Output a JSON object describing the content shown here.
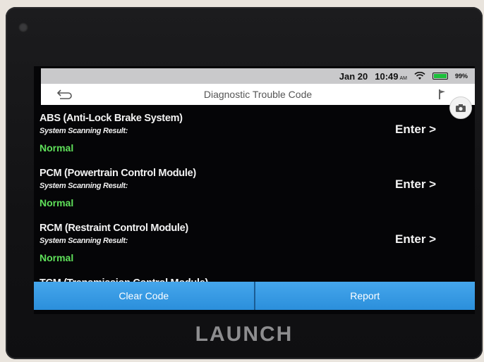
{
  "status": {
    "date": "Jan 20",
    "time": "10:49",
    "ampm": "AM",
    "battery": "99%"
  },
  "header": {
    "title": "Diagnostic Trouble Code"
  },
  "systems": [
    {
      "title": "ABS (Anti-Lock Brake System)",
      "subtitle": "System Scanning Result:",
      "status": "Normal",
      "action": "Enter >"
    },
    {
      "title": "PCM (Powertrain Control Module)",
      "subtitle": "System Scanning Result:",
      "status": "Normal",
      "action": "Enter >"
    },
    {
      "title": "RCM (Restraint Control Module)",
      "subtitle": "System Scanning Result:",
      "status": "Normal",
      "action": "Enter >"
    }
  ],
  "partial_item": "TCM (Transmission Control Module)",
  "buttons": {
    "clear": "Clear Code",
    "report": "Report"
  },
  "brand": "LAUNCH",
  "colors": {
    "status_normal": "#5fe05a",
    "button_blue": "#2b8fdb",
    "screen_bg": "#050507"
  }
}
